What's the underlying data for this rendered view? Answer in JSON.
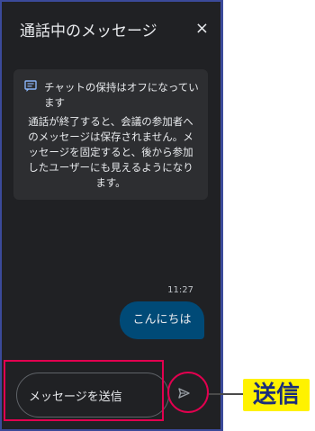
{
  "panel": {
    "title": "通話中のメッセージ",
    "close_icon": "×"
  },
  "info_card": {
    "icon": "chat-icon",
    "title": "チャットの保持はオフになっています",
    "body": "通話が終了すると、会議の参加者へのメッセージは保存されません。メッセージを固定すると、後から参加したユーザーにも見えるようになります。"
  },
  "message": {
    "time": "11:27",
    "text": "こんにちは"
  },
  "composer": {
    "placeholder": "メッセージを送信",
    "send_icon": "send-icon"
  },
  "annotation": {
    "label": "送信"
  },
  "colors": {
    "panel_bg": "#202124",
    "card_bg": "#2d2e31",
    "bubble_bg": "#004a77",
    "highlight": "#e2004f",
    "callout_bg": "#fff200",
    "callout_text": "#1b2d7a"
  }
}
